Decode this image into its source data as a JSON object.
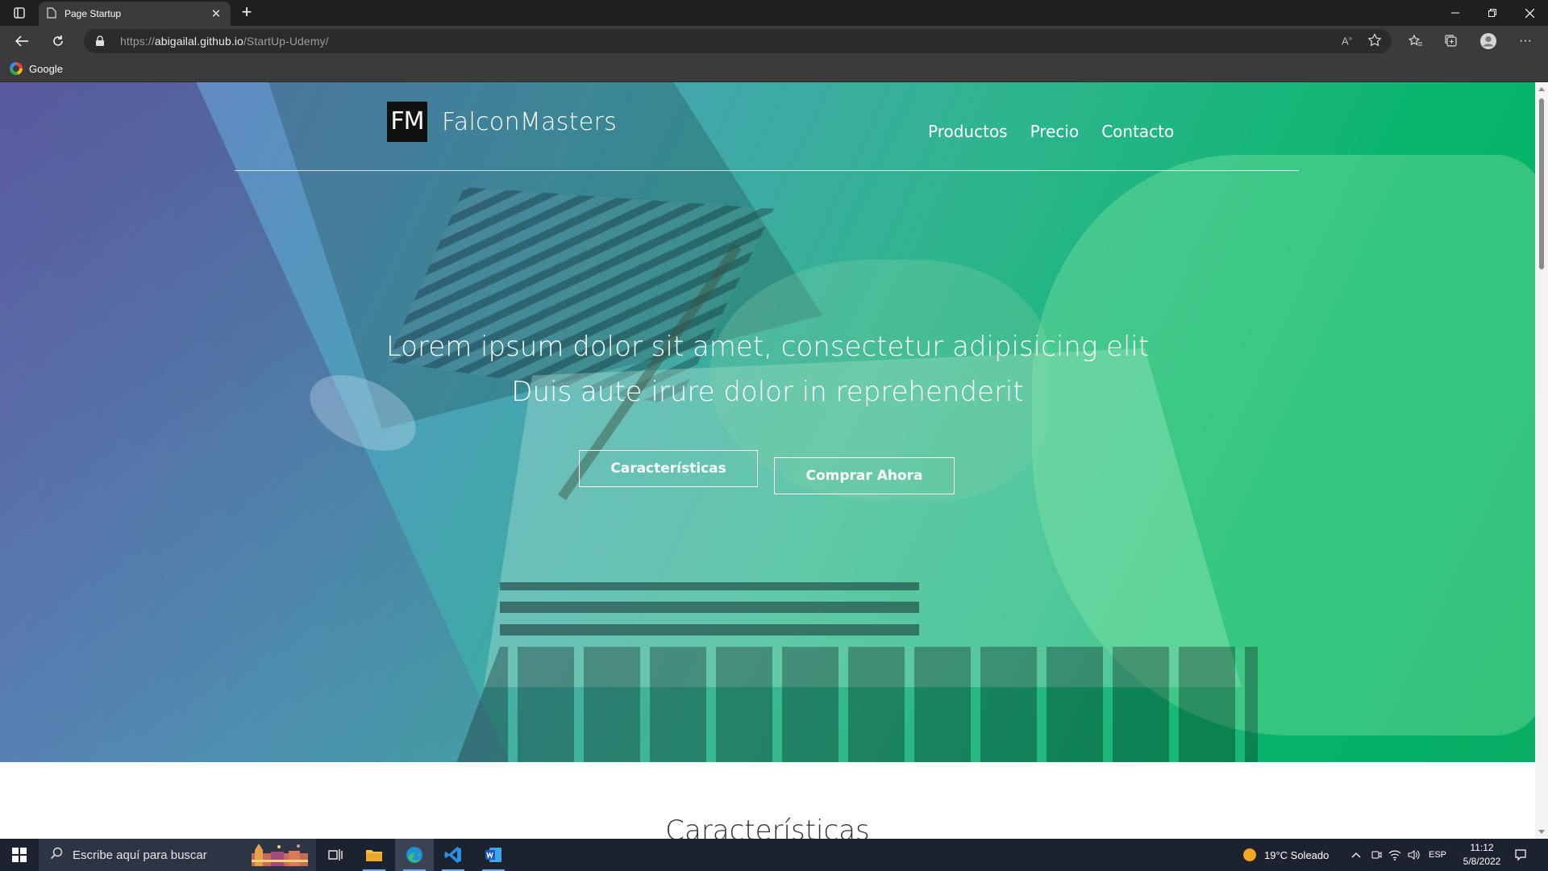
{
  "browser": {
    "tab_title": "Page Startup",
    "url_prefix": "https://",
    "url_host": "abigailal.github.io",
    "url_path": "/StartUp-Udemy/",
    "favorites": [
      {
        "label": "Google"
      }
    ]
  },
  "page": {
    "brand_logo": "FM",
    "brand_name": "FalconMasters",
    "nav": [
      "Productos",
      "Precio",
      "Contacto"
    ],
    "headline_line1": "Lorem ipsum dolor sit amet, consectetur adipisicing elit",
    "headline_line2": "Duis aute irure dolor in reprehenderit",
    "cta_features": "Características",
    "cta_buy": "Comprar Ahora",
    "section_title": "Características",
    "colors": {
      "gradient_start": "#6f7cc9",
      "gradient_end": "#07ad64"
    }
  },
  "taskbar": {
    "search_placeholder": "Escribe aquí para buscar",
    "weather": "19°C  Soleado",
    "language": "ESP",
    "time": "11:12",
    "date": "5/8/2022"
  }
}
